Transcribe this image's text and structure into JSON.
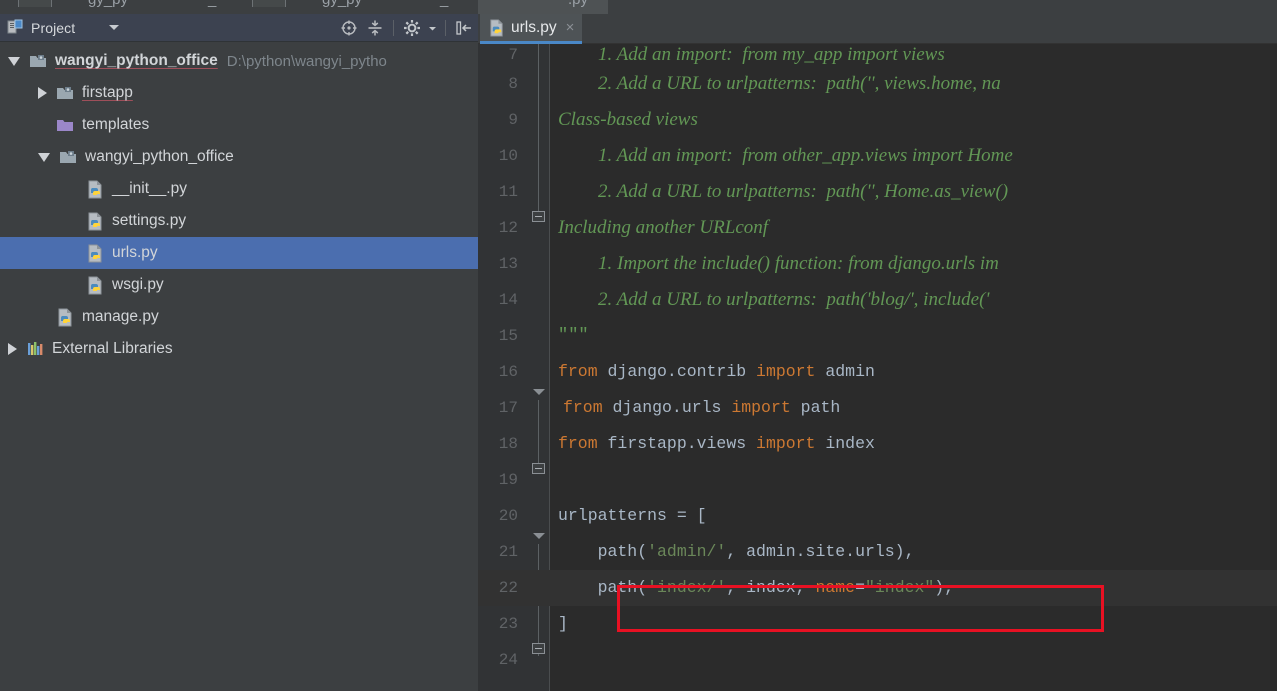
{
  "window": {
    "sidebar_bg": "#3c3f41",
    "editor_bg": "#2b2b2b",
    "selection_blue": "#4b6eaf",
    "annotation_color": "#e81123"
  },
  "top_strip": {
    "ghost_labels": [
      "gy_py",
      "_",
      "gy_py",
      "_",
      ".py"
    ]
  },
  "project_panel": {
    "title": "Project",
    "icons": {
      "panel": "project-panel-icon",
      "dropdown": "chevron-down-icon",
      "locate": "locate-target-icon",
      "collapse_all": "collapse-all-icon",
      "settings": "gear-icon",
      "settings_caret": "chevron-down-icon",
      "hide": "hide-panel-icon"
    },
    "tree": [
      {
        "label": "wangyi_python_office",
        "subpath": "D:\\python\\wangyi_pytho",
        "icon": "folder-module-icon",
        "arrow": "expanded",
        "indent": 8,
        "bold": true,
        "selected": false
      },
      {
        "label": "firstapp",
        "subpath": "",
        "icon": "folder-module-icon",
        "arrow": "collapsed",
        "indent": 38,
        "bold": false,
        "selected": false
      },
      {
        "label": "templates",
        "subpath": "",
        "icon": "folder-purple-icon",
        "arrow": "none",
        "indent": 38,
        "bold": false,
        "selected": false
      },
      {
        "label": "wangyi_python_office",
        "subpath": "",
        "icon": "folder-module-icon",
        "arrow": "expanded",
        "indent": 38,
        "bold": false,
        "selected": false
      },
      {
        "label": "__init__.py",
        "subpath": "",
        "icon": "python-file-icon",
        "arrow": "none",
        "indent": 68,
        "bold": false,
        "selected": false
      },
      {
        "label": "settings.py",
        "subpath": "",
        "icon": "python-file-icon",
        "arrow": "none",
        "indent": 68,
        "bold": false,
        "selected": false
      },
      {
        "label": "urls.py",
        "subpath": "",
        "icon": "python-file-icon",
        "arrow": "none",
        "indent": 68,
        "bold": false,
        "selected": true
      },
      {
        "label": "wsgi.py",
        "subpath": "",
        "icon": "python-file-icon",
        "arrow": "none",
        "indent": 68,
        "bold": false,
        "selected": false
      },
      {
        "label": "manage.py",
        "subpath": "",
        "icon": "python-file-icon",
        "arrow": "none",
        "indent": 38,
        "bold": false,
        "selected": false
      },
      {
        "label": "External Libraries",
        "subpath": "",
        "icon": "libraries-icon",
        "arrow": "collapsed",
        "indent": 8,
        "bold": false,
        "selected": false
      }
    ]
  },
  "editor": {
    "tab": {
      "label": "urls.py",
      "close": "×",
      "icon": "python-file-icon"
    },
    "caret_line": 22,
    "lines": [
      {
        "num": "7",
        "indent": 4,
        "type": "doc",
        "text": "1. Add an import:  from my_app import views"
      },
      {
        "num": "8",
        "indent": 4,
        "type": "doc",
        "text": "2. Add a URL to urlpatterns:  path('', views.home, na"
      },
      {
        "num": "9",
        "indent": 0,
        "type": "doc",
        "text": "Class-based views"
      },
      {
        "num": "10",
        "indent": 4,
        "type": "doc",
        "text": "1. Add an import:  from other_app.views import Home"
      },
      {
        "num": "11",
        "indent": 4,
        "type": "doc",
        "text": "2. Add a URL to urlpatterns:  path('', Home.as_view()"
      },
      {
        "num": "12",
        "indent": 0,
        "type": "doc",
        "text": "Including another URLconf"
      },
      {
        "num": "13",
        "indent": 4,
        "type": "doc",
        "text": "1. Import the include() function: from django.urls im"
      },
      {
        "num": "14",
        "indent": 4,
        "type": "doc",
        "text": "2. Add a URL to urlpatterns:  path('blog/', include('"
      },
      {
        "num": "15",
        "indent": 0,
        "type": "docq",
        "text": "\"\"\""
      },
      {
        "num": "16",
        "indent": 0,
        "type": "code",
        "tokens": [
          {
            "t": "from",
            "c": "kw"
          },
          {
            "t": " django.contrib ",
            "c": "plain"
          },
          {
            "t": "import",
            "c": "kw"
          },
          {
            "t": " admin",
            "c": "plain"
          }
        ]
      },
      {
        "num": "17",
        "indent": 0,
        "type": "code",
        "tokens": [
          {
            "t": "from",
            "c": "kw"
          },
          {
            "t": " django.urls ",
            "c": "plain"
          },
          {
            "t": "import",
            "c": "kw"
          },
          {
            "t": " path",
            "c": "plain"
          }
        ]
      },
      {
        "num": "18",
        "indent": 0,
        "type": "code",
        "tokens": [
          {
            "t": "from",
            "c": "kw"
          },
          {
            "t": " firstapp.views ",
            "c": "plain"
          },
          {
            "t": "import",
            "c": "kw"
          },
          {
            "t": " index",
            "c": "plain"
          }
        ]
      },
      {
        "num": "19",
        "indent": 0,
        "type": "code",
        "tokens": []
      },
      {
        "num": "20",
        "indent": 0,
        "type": "code",
        "tokens": [
          {
            "t": "urlpatterns = [",
            "c": "plain"
          }
        ]
      },
      {
        "num": "21",
        "indent": 0,
        "type": "code",
        "tokens": [
          {
            "t": "    path(",
            "c": "plain"
          },
          {
            "t": "'admin/'",
            "c": "str"
          },
          {
            "t": ", admin.site.urls),",
            "c": "plain"
          }
        ]
      },
      {
        "num": "22",
        "indent": 0,
        "type": "code",
        "tokens": [
          {
            "t": "    path(",
            "c": "plain"
          },
          {
            "t": "'index/'",
            "c": "str"
          },
          {
            "t": ", index, ",
            "c": "plain"
          },
          {
            "t": "name",
            "c": "kw"
          },
          {
            "t": "=",
            "c": "plain"
          },
          {
            "t": "\"index\"",
            "c": "str"
          },
          {
            "t": "),",
            "c": "plain"
          }
        ]
      },
      {
        "num": "23",
        "indent": 0,
        "type": "code",
        "tokens": [
          {
            "t": "]",
            "c": "plain"
          }
        ]
      },
      {
        "num": "24",
        "indent": 0,
        "type": "code",
        "tokens": []
      }
    ],
    "annotation": {
      "name": "red-highlight-rectangle",
      "line": "22"
    }
  }
}
